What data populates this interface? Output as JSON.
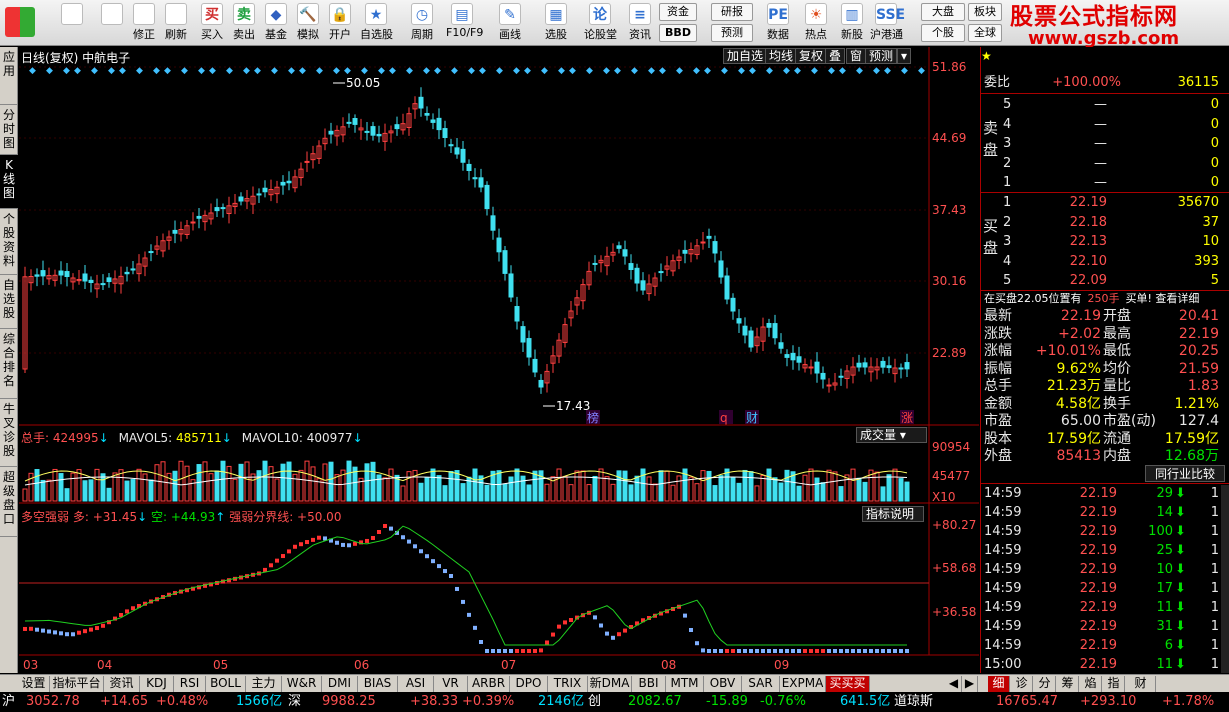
{
  "toolbar": {
    "buttons": [
      {
        "label": ""
      },
      {
        "label": ""
      },
      {
        "label": "修正"
      },
      {
        "label": "刷新"
      },
      {
        "label": "买入"
      },
      {
        "label": "卖出"
      },
      {
        "label": "基金"
      },
      {
        "label": "模拟"
      },
      {
        "label": "开户"
      },
      {
        "label": "自选股"
      },
      {
        "label": "周期"
      },
      {
        "label": "F10/F9"
      },
      {
        "label": "画线"
      },
      {
        "label": "选股"
      },
      {
        "label": "论股堂"
      },
      {
        "label": "资讯"
      },
      {
        "label": "数据"
      },
      {
        "label": "热点"
      },
      {
        "label": "新股"
      },
      {
        "label": "沪港通"
      }
    ],
    "icon_chars": [
      "",
      "",
      "",
      "",
      "买",
      "卖",
      "◆",
      "🔨",
      "🔒",
      "★",
      "◷",
      "▤",
      "✎",
      "▦",
      "论",
      "≡",
      "PE",
      "☀",
      "▥",
      "SSE"
    ],
    "small": {
      "zijin": "资金",
      "bbd": "BBD",
      "yanbao": "研报",
      "yuce": "预测",
      "dapan": "大盘",
      "gegu": "个股",
      "bankuai": "板块",
      "quanqiu": "全球"
    }
  },
  "logo": {
    "line1": "股票公式指标网",
    "line2": "www.gszb.com"
  },
  "left_tabs": [
    "应用",
    "分时图",
    "K线图",
    "个股资料",
    "自选股",
    "综合排名",
    "牛叉诊股",
    "超级盘口"
  ],
  "chart": {
    "title": "日线(复权) 中航电子",
    "buttons": [
      "加自选",
      "均线",
      "复权",
      "叠",
      "窗",
      "预测"
    ],
    "price_axis": [
      "51.86",
      "44.69",
      "37.43",
      "30.16",
      "22.89"
    ],
    "high_label": "50.05",
    "low_label": "17.43",
    "events": [
      "榜",
      "q",
      "财",
      "涨"
    ],
    "volume_header": {
      "zongshou_label": "总手: ",
      "zongshou": "424995",
      "mavol5_label": "MAVOL5: ",
      "mavol5": "485711",
      "mavol10_label": "MAVOL10: ",
      "mavol10": "400977"
    },
    "volume_button": "成交量",
    "volume_axis": [
      "90954",
      "45477",
      "X10"
    ],
    "indicator_header": {
      "name": "多空强弱",
      "duo": "多: +31.45",
      "kong": "空: +44.93",
      "line": "强弱分界线: +50.00"
    },
    "indicator_button": "指标说明",
    "indicator_axis": [
      "+80.27",
      "+58.68",
      "+36.58"
    ],
    "months": [
      "03",
      "04",
      "05",
      "06",
      "07",
      "08",
      "09"
    ]
  },
  "chart_data": {
    "type": "candlestick",
    "title": "中航电子",
    "ylim": [
      17.43,
      51.86
    ],
    "high": 50.05,
    "low": 17.43,
    "last_close": 22.19
  },
  "quote": {
    "weibi_label": "委比",
    "weibi": "+100.00%",
    "weicha": "36115",
    "sell_label": "卖盘",
    "sells": [
      {
        "n": "5",
        "p": "—",
        "v": "0"
      },
      {
        "n": "4",
        "p": "—",
        "v": "0"
      },
      {
        "n": "3",
        "p": "—",
        "v": "0"
      },
      {
        "n": "2",
        "p": "—",
        "v": "0"
      },
      {
        "n": "1",
        "p": "—",
        "v": "0"
      }
    ],
    "buy_label": "买盘",
    "buys": [
      {
        "n": "1",
        "p": "22.19",
        "v": "35670"
      },
      {
        "n": "2",
        "p": "22.18",
        "v": "37"
      },
      {
        "n": "3",
        "p": "22.13",
        "v": "10"
      },
      {
        "n": "4",
        "p": "22.10",
        "v": "393"
      },
      {
        "n": "5",
        "p": "22.09",
        "v": "5"
      }
    ],
    "notice": "在买盘22.05位置有",
    "notice_vol": "250手",
    "notice_link": "买单! 查看详细",
    "stats": [
      {
        "l1": "最新",
        "v1": "22.19",
        "l2": "开盘",
        "v2": "20.41"
      },
      {
        "l1": "涨跌",
        "v1": "+2.02",
        "l2": "最高",
        "v2": "22.19"
      },
      {
        "l1": "涨幅",
        "v1": "+10.01%",
        "l2": "最低",
        "v2": "20.25"
      },
      {
        "l1": "振幅",
        "v1": "9.62%",
        "l2": "均价",
        "v2": "21.59"
      },
      {
        "l1": "总手",
        "v1": "21.23万",
        "l2": "量比",
        "v2": "1.83"
      },
      {
        "l1": "金额",
        "v1": "4.58亿",
        "l2": "换手",
        "v2": "1.21%"
      },
      {
        "l1": "市盈",
        "v1": "65.00",
        "l2": "市盈(动)",
        "v2": "127.4"
      },
      {
        "l1": "股本",
        "v1": "17.59亿",
        "l2": "流通",
        "v2": "17.59亿"
      },
      {
        "l1": "外盘",
        "v1": "85413",
        "l2": "内盘",
        "v2": "12.68万"
      }
    ],
    "compare_btn": "同行业比较",
    "ticks": [
      {
        "t": "14:59",
        "p": "22.19",
        "v": "29",
        "x": "1"
      },
      {
        "t": "14:59",
        "p": "22.19",
        "v": "14",
        "x": "1"
      },
      {
        "t": "14:59",
        "p": "22.19",
        "v": "100",
        "x": "1"
      },
      {
        "t": "14:59",
        "p": "22.19",
        "v": "25",
        "x": "1"
      },
      {
        "t": "14:59",
        "p": "22.19",
        "v": "10",
        "x": "1"
      },
      {
        "t": "14:59",
        "p": "22.19",
        "v": "17",
        "x": "1"
      },
      {
        "t": "14:59",
        "p": "22.19",
        "v": "11",
        "x": "1"
      },
      {
        "t": "14:59",
        "p": "22.19",
        "v": "31",
        "x": "1"
      },
      {
        "t": "14:59",
        "p": "22.19",
        "v": "6",
        "x": "1"
      },
      {
        "t": "15:00",
        "p": "22.19",
        "v": "11",
        "x": "1"
      }
    ],
    "tabs": [
      "细",
      "诊",
      "分",
      "筹",
      "焰",
      "指",
      "财"
    ]
  },
  "bottom_tabs": [
    "设置",
    "指标平台",
    "资讯",
    "KDJ",
    "RSI",
    "BOLL",
    "主力",
    "W&R",
    "DMI",
    "BIAS",
    "ASI",
    "VR",
    "ARBR",
    "DPO",
    "TRIX",
    "新DMA",
    "BBI",
    "MTM",
    "OBV",
    "SAR",
    "EXPMA",
    "买买买"
  ],
  "status": {
    "sh_label": "沪",
    "sh": "3052.78",
    "sh_chg": "+14.65",
    "sh_pct": "+0.48%",
    "sh_amt": "1566亿",
    "sz_label": "深",
    "sz": "9988.25",
    "sz_chg": "+38.33",
    "sz_pct": "+0.39%",
    "sz_amt": "2146亿",
    "cy_label": "创",
    "cy": "2082.67",
    "cy_chg": "-15.89",
    "cy_pct": "-0.76%",
    "cy_amt": "641.5亿",
    "dj_label": "道琼斯",
    "dj": "16765.47",
    "dj_chg": "+293.10",
    "dj_pct": "+1.78%"
  }
}
